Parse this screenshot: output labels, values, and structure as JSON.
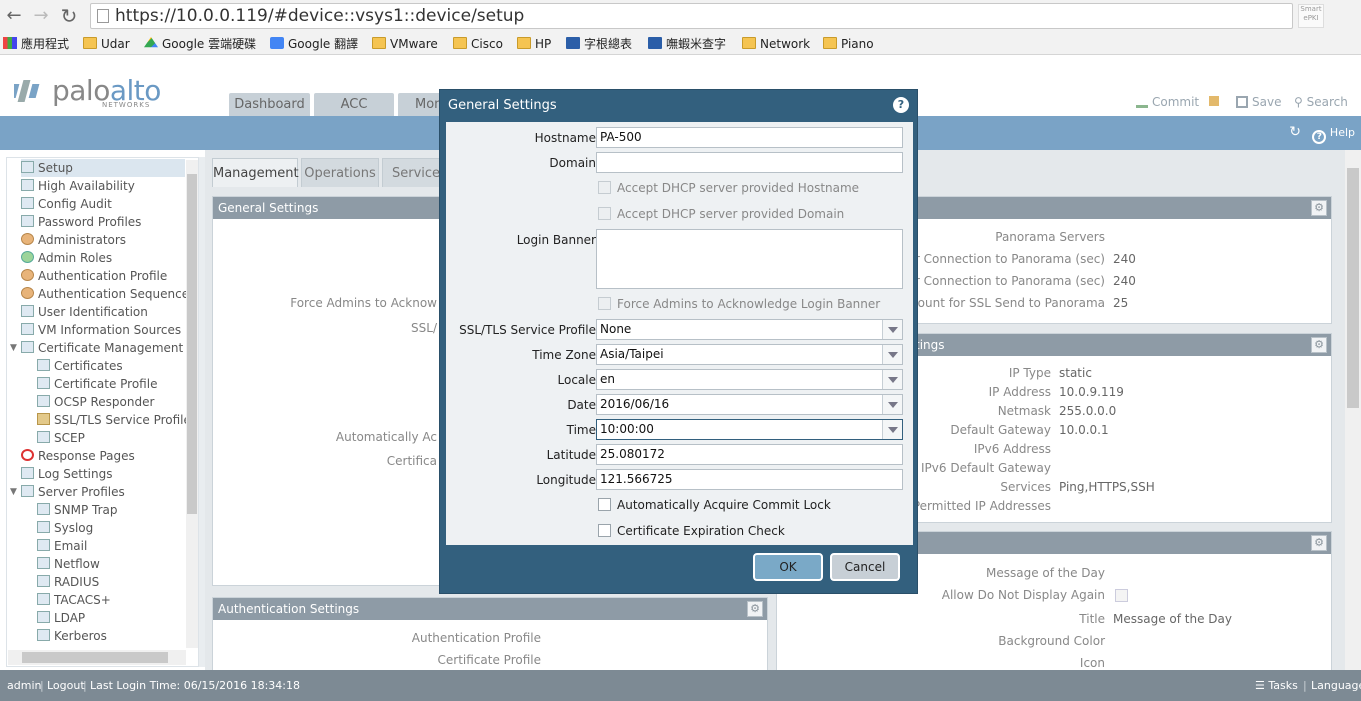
{
  "browser": {
    "url": "https://10.0.0.119/#device::vsys1::device/setup",
    "smart_label": "Smart\nePKI",
    "bookmarks": [
      "應用程式",
      "Udar",
      "Google 雲端硬碟",
      "Google 翻譯",
      "VMware",
      "Cisco",
      "HP",
      "字根總表",
      "嘸蝦米查字",
      "Network",
      "Piano"
    ]
  },
  "header": {
    "logo_palo": "palo",
    "logo_alto": "alto",
    "logo_sub": "NETWORKS",
    "tabs": [
      "Dashboard",
      "ACC",
      "Mon"
    ],
    "commit": "Commit",
    "save": "Save",
    "search": "Search",
    "help": "Help"
  },
  "tree": {
    "items": [
      "Setup",
      "High Availability",
      "Config Audit",
      "Password Profiles",
      "Administrators",
      "Admin Roles",
      "Authentication Profile",
      "Authentication Sequence",
      "User Identification",
      "VM Information Sources",
      "Certificate Management",
      "Certificates",
      "Certificate Profile",
      "OCSP Responder",
      "SSL/TLS Service Profile",
      "SCEP",
      "Response Pages",
      "Log Settings",
      "Server Profiles",
      "SNMP Trap",
      "Syslog",
      "Email",
      "Netflow",
      "RADIUS",
      "TACACS+",
      "LDAP",
      "Kerberos"
    ]
  },
  "subtabs": [
    "Management",
    "Operations",
    "Services"
  ],
  "background": {
    "general_settings_title": "General Settings",
    "gs_labels": [
      "Force Admins to Acknow",
      "SSL/",
      "Automatically Ac",
      "Certifica"
    ],
    "panorama_labels": [
      "Panorama Servers",
      "for Connection to Panorama (sec)",
      "for Connection to Panorama (sec)",
      "y Count for SSL Send to Panorama"
    ],
    "panorama_values": [
      "",
      "240",
      "240",
      "25"
    ],
    "interface_title_tail": "tings",
    "iface_labels": [
      "IP Type",
      "IP Address",
      "Netmask",
      "Default Gateway",
      "IPv6 Address",
      "IPv6 Default Gateway",
      "Services",
      "Permitted IP Addresses"
    ],
    "iface_values": [
      "static",
      "10.0.9.119",
      "255.0.0.0",
      "10.0.0.1",
      "",
      "",
      "Ping,HTTPS,SSH",
      ""
    ],
    "auth_title": "Authentication Settings",
    "auth_labels": [
      "Authentication Profile",
      "Certificate Profile"
    ],
    "banner_labels": [
      "Message of the Day",
      "Allow Do Not Display Again",
      "Title",
      "Background Color",
      "Icon"
    ],
    "banner_title_value": "Message of the Day"
  },
  "status": {
    "user": "admin",
    "logout": "Logout",
    "last_login": "Last Login Time: 06/15/2016 18:34:18",
    "tasks": "Tasks",
    "language": "Language"
  },
  "modal": {
    "title": "General Settings",
    "hostname_label": "Hostname",
    "hostname": "PA-500",
    "domain_label": "Domain",
    "domain": "",
    "dhcp_hostname": "Accept DHCP server provided Hostname",
    "dhcp_domain": "Accept DHCP server provided Domain",
    "login_banner_label": "Login Banner",
    "force_ack": "Force Admins to Acknowledge Login Banner",
    "ssl_label": "SSL/TLS Service Profile",
    "ssl_value": "None",
    "tz_label": "Time Zone",
    "tz_value": "Asia/Taipei",
    "locale_label": "Locale",
    "locale_value": "en",
    "date_label": "Date",
    "date_value": "2016/06/16",
    "time_label": "Time",
    "time_value": "10:00:00",
    "lat_label": "Latitude",
    "lat_value": "25.080172",
    "lon_label": "Longitude",
    "lon_value": "121.566725",
    "auto_commit": "Automatically Acquire Commit Lock",
    "cert_exp": "Certificate Expiration Check",
    "ok": "OK",
    "cancel": "Cancel"
  },
  "colors": {
    "header_blue": "#7aa3c6",
    "modal_blue": "#33607e",
    "section_head": "#8e9ba6"
  }
}
